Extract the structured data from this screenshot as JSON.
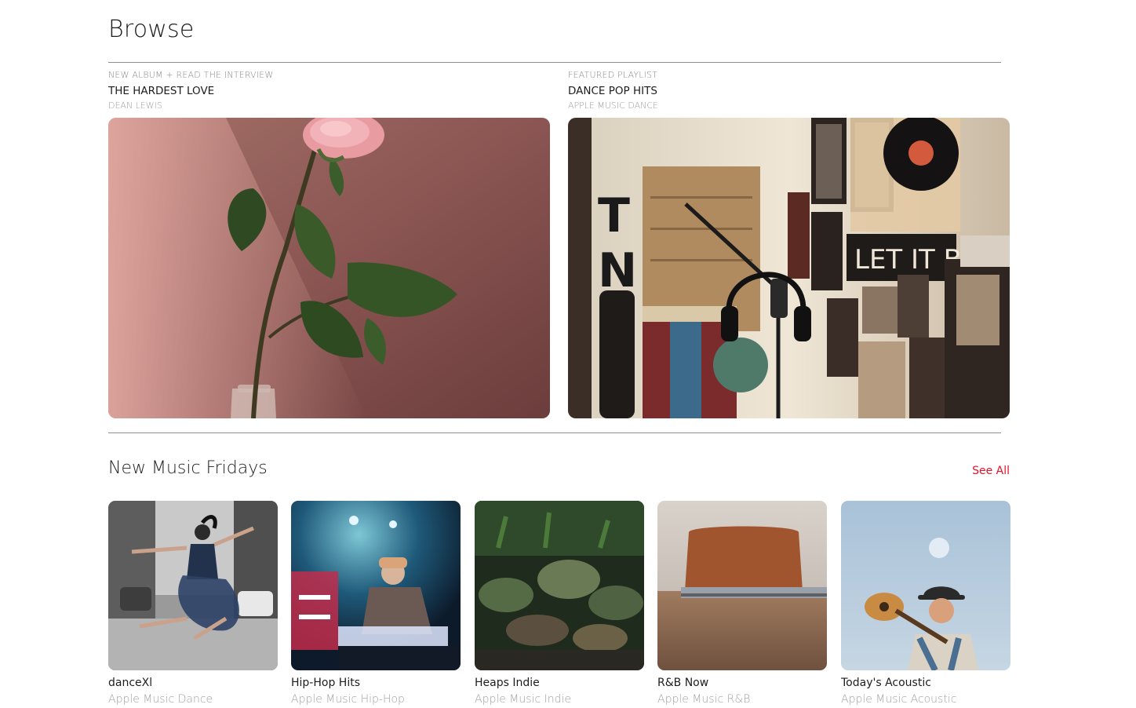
{
  "page": {
    "title": "Browse"
  },
  "features": [
    {
      "eyebrow": "NEW ALBUM + READ THE INTERVIEW",
      "headline": "THE HARDEST LOVE",
      "sub": "DEAN LEWIS",
      "artwork_icon": "rose-photo"
    },
    {
      "eyebrow": "FEATURED PLAYLIST",
      "headline": "DANCE POP HITS",
      "sub": "APPLE MUSIC DANCE",
      "artwork_icon": "studio-microphone-photo",
      "artwork_texts": {
        "let_it_be": "LET IT BE",
        "t": "T",
        "n": "N"
      }
    }
  ],
  "section": {
    "title": "New Music Fridays",
    "see_all": "See All",
    "cards": [
      {
        "name": "danceXl",
        "curator": "Apple Music Dance"
      },
      {
        "name": "Hip-Hop Hits",
        "curator": "Apple Music Hip-Hop"
      },
      {
        "name": "Heaps Indie",
        "curator": "Apple Music Indie"
      },
      {
        "name": "R&B Now",
        "curator": "Apple Music R&B"
      },
      {
        "name": "Today's Acoustic",
        "curator": "Apple Music Acoustic"
      }
    ]
  },
  "colors": {
    "accent": "#e3142b",
    "text": "#1d1d1f",
    "secondary": "#86868b",
    "divider": "#8e8e93"
  }
}
